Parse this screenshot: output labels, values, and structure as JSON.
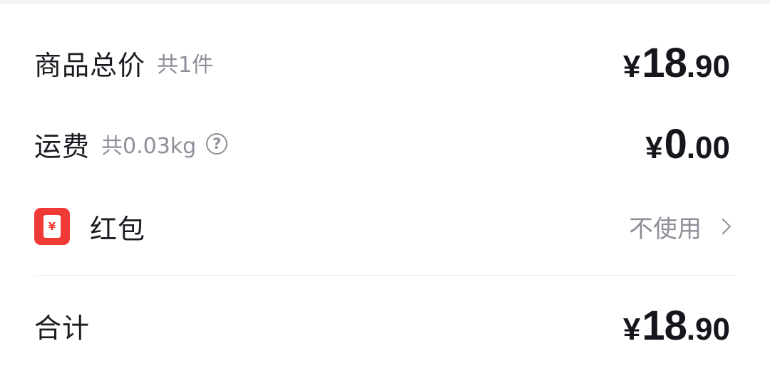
{
  "order_summary": {
    "goods": {
      "label": "商品总价",
      "count_text": "共1件",
      "price": {
        "symbol": "¥",
        "integer": "18",
        "decimal": ".90"
      }
    },
    "shipping": {
      "label": "运费",
      "weight_text": "共0.03kg",
      "price": {
        "symbol": "¥",
        "integer": "0",
        "decimal": ".00"
      }
    },
    "red_packet": {
      "icon_glyph": "¥",
      "label": "红包",
      "action": "不使用"
    },
    "total": {
      "label": "合计",
      "price": {
        "symbol": "¥",
        "integer": "18",
        "decimal": ".90"
      }
    }
  },
  "colors": {
    "accent_red": "#f03a35",
    "text_primary": "#1a1c22",
    "text_secondary": "#8d9098"
  }
}
